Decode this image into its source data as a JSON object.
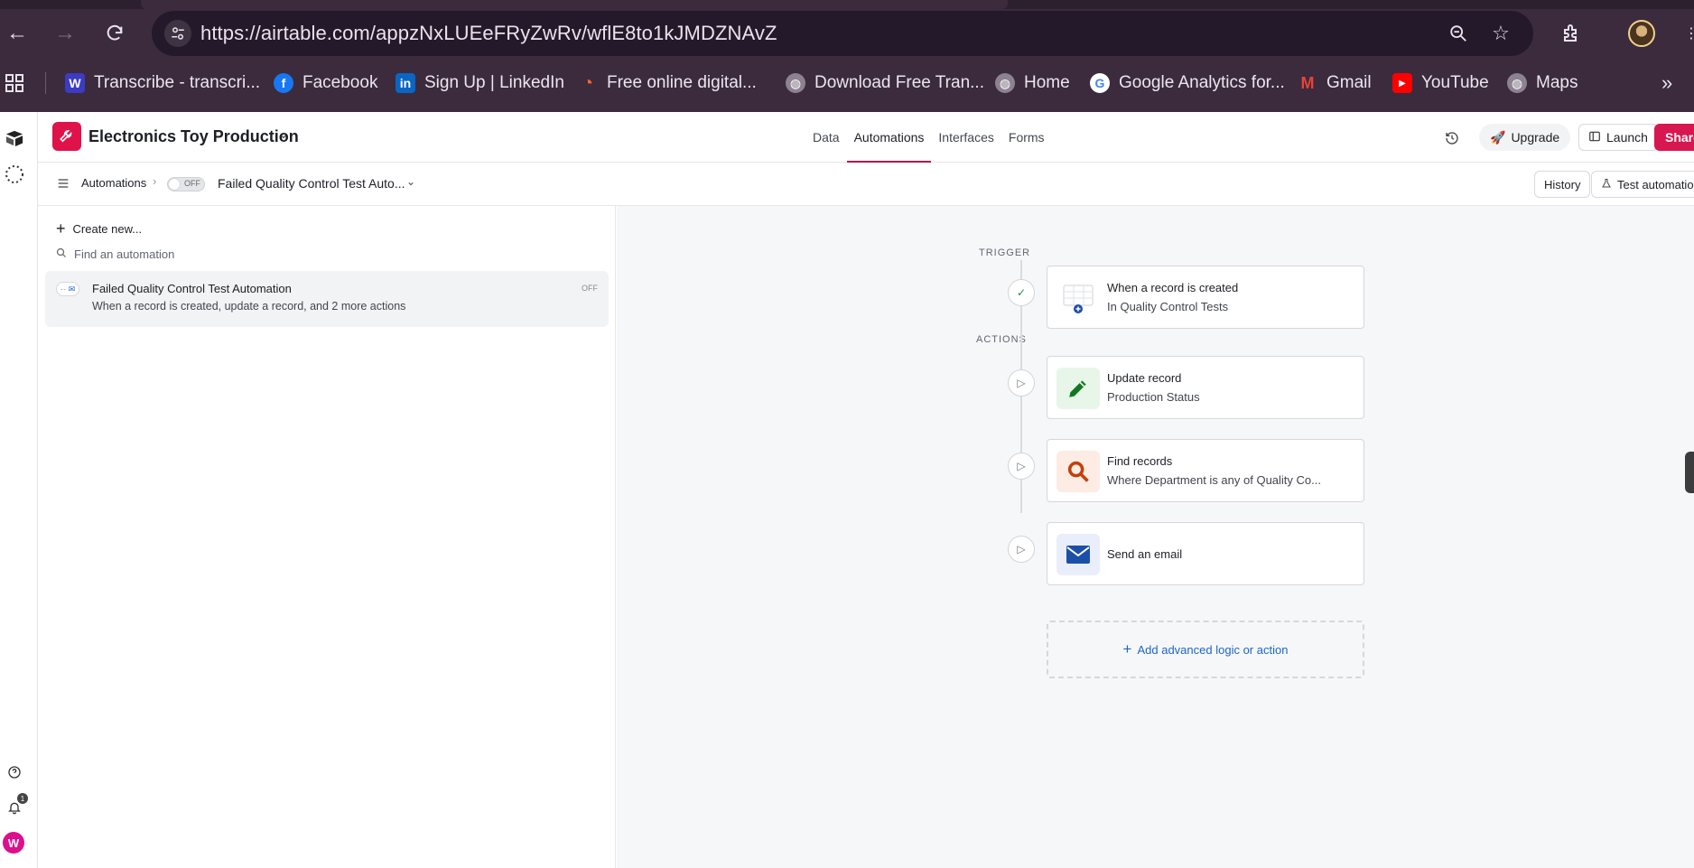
{
  "browser": {
    "url": "https://airtable.com/appzNxLUEeFRyZwRv/wflE8to1kJMDZNAvZ",
    "bookmarks": [
      {
        "label": "Transcribe - transcri...",
        "icon": "transcribe-favicon",
        "color": "#3b3bc4"
      },
      {
        "label": "Facebook",
        "icon": "facebook-favicon",
        "color": "#1877f2"
      },
      {
        "label": "Sign Up | LinkedIn",
        "icon": "linkedin-favicon",
        "color": "#0a66c2"
      },
      {
        "label": "Free online digital...",
        "icon": "semrush-favicon",
        "color": "#ff642d"
      },
      {
        "label": "Download Free Tran...",
        "icon": "globe-favicon",
        "color": "#9a9a9a"
      },
      {
        "label": "Home",
        "icon": "globe-favicon",
        "color": "#9a9a9a"
      },
      {
        "label": "Google Analytics for...",
        "icon": "google-favicon",
        "color": "#4285f4"
      },
      {
        "label": "Gmail",
        "icon": "gmail-favicon",
        "color": "#ea4335"
      },
      {
        "label": "YouTube",
        "icon": "youtube-favicon",
        "color": "#ff0000"
      },
      {
        "label": "Maps",
        "icon": "globe-favicon",
        "color": "#9a9a9a"
      }
    ]
  },
  "app": {
    "base_name": "Electronics Toy Production",
    "accent_color": "#e0124a",
    "tabs": [
      {
        "label": "Data",
        "active": false
      },
      {
        "label": "Automations",
        "active": true
      },
      {
        "label": "Interfaces",
        "active": false
      },
      {
        "label": "Forms",
        "active": false
      }
    ],
    "upgrade_label": "Upgrade",
    "launch_label": "Launch",
    "share_label": "Share",
    "avatar_initial": "W",
    "notification_count": "1"
  },
  "subbar": {
    "breadcrumb": "Automations",
    "toggle_label": "OFF",
    "automation_name": "Failed Quality Control Test Auto...",
    "history_label": "History",
    "test_label": "Test automation"
  },
  "sidebar": {
    "create_new": "Create new...",
    "search_placeholder": "Find an automation",
    "items": [
      {
        "title": "Failed Quality Control Test Automation",
        "subtitle": "When a record is created, update a record, and 2 more actions",
        "status": "OFF"
      }
    ]
  },
  "flow": {
    "trigger_label": "TRIGGER",
    "actions_label": "ACTIONS",
    "trigger": {
      "title": "When a record is created",
      "subtitle": "In Quality Control Tests"
    },
    "actions": [
      {
        "title": "Update record",
        "subtitle": "Production Status",
        "icon": "pencil-icon",
        "color": "#0f7a1f"
      },
      {
        "title": "Find records",
        "subtitle": "Where Department is any of Quality Co...",
        "icon": "search-icon",
        "color": "#c2410c"
      },
      {
        "title": "Send an email",
        "subtitle": "",
        "icon": "envelope-icon",
        "color": "#1c4fa8"
      }
    ],
    "add_label": "Add advanced logic or action"
  }
}
